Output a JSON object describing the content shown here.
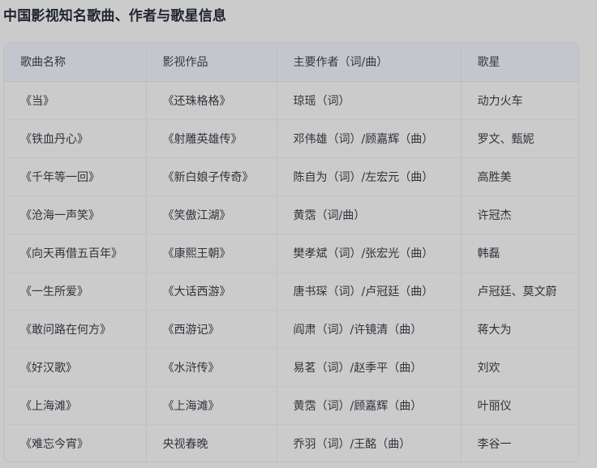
{
  "page": {
    "title": "中国影视知名歌曲、作者与歌星信息"
  },
  "table": {
    "headers": [
      "歌曲名称",
      "影视作品",
      "主要作者（词/曲）",
      "歌星"
    ],
    "rows": [
      [
        "《当》",
        "《还珠格格》",
        "琼瑶（词）",
        "动力火车"
      ],
      [
        "《铁血丹心》",
        "《射雕英雄传》",
        "邓伟雄（词）/顾嘉辉（曲）",
        "罗文、甄妮"
      ],
      [
        "《千年等一回》",
        "《新白娘子传奇》",
        "陈自为（词）/左宏元（曲）",
        "高胜美"
      ],
      [
        "《沧海一声笑》",
        "《笑傲江湖》",
        "黄霑（词/曲）",
        "许冠杰"
      ],
      [
        "《向天再借五百年》",
        "《康熙王朝》",
        "樊孝斌（词）/张宏光（曲）",
        "韩磊"
      ],
      [
        "《一生所爱》",
        "《大话西游》",
        "唐书琛（词）/卢冠廷（曲）",
        "卢冠廷、莫文蔚"
      ],
      [
        "《敢问路在何方》",
        "《西游记》",
        "阎肃（词）/许镜清（曲）",
        "蒋大为"
      ],
      [
        "《好汉歌》",
        "《水浒传》",
        "易茗（词）/赵季平（曲）",
        "刘欢"
      ],
      [
        "《上海滩》",
        "《上海滩》",
        "黄霑（词）/顾嘉辉（曲）",
        "叶丽仪"
      ],
      [
        "《难忘今宵》",
        "央视春晚",
        "乔羽（词）/王酩（曲）",
        "李谷一"
      ]
    ]
  }
}
